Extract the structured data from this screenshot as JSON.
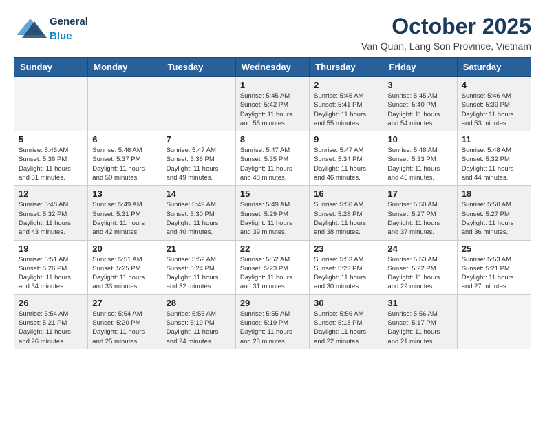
{
  "logo": {
    "general": "General",
    "blue": "Blue"
  },
  "title": "October 2025",
  "subtitle": "Van Quan, Lang Son Province, Vietnam",
  "weekdays": [
    "Sunday",
    "Monday",
    "Tuesday",
    "Wednesday",
    "Thursday",
    "Friday",
    "Saturday"
  ],
  "weeks": [
    [
      {
        "day": "",
        "empty": true
      },
      {
        "day": "",
        "empty": true
      },
      {
        "day": "",
        "empty": true
      },
      {
        "day": "1",
        "sunrise": "5:45 AM",
        "sunset": "5:42 PM",
        "daylight": "11 hours and 56 minutes."
      },
      {
        "day": "2",
        "sunrise": "5:45 AM",
        "sunset": "5:41 PM",
        "daylight": "11 hours and 55 minutes."
      },
      {
        "day": "3",
        "sunrise": "5:45 AM",
        "sunset": "5:40 PM",
        "daylight": "11 hours and 54 minutes."
      },
      {
        "day": "4",
        "sunrise": "5:46 AM",
        "sunset": "5:39 PM",
        "daylight": "11 hours and 53 minutes."
      }
    ],
    [
      {
        "day": "5",
        "sunrise": "5:46 AM",
        "sunset": "5:38 PM",
        "daylight": "11 hours and 51 minutes."
      },
      {
        "day": "6",
        "sunrise": "5:46 AM",
        "sunset": "5:37 PM",
        "daylight": "11 hours and 50 minutes."
      },
      {
        "day": "7",
        "sunrise": "5:47 AM",
        "sunset": "5:36 PM",
        "daylight": "11 hours and 49 minutes."
      },
      {
        "day": "8",
        "sunrise": "5:47 AM",
        "sunset": "5:35 PM",
        "daylight": "11 hours and 48 minutes."
      },
      {
        "day": "9",
        "sunrise": "5:47 AM",
        "sunset": "5:34 PM",
        "daylight": "11 hours and 46 minutes."
      },
      {
        "day": "10",
        "sunrise": "5:48 AM",
        "sunset": "5:33 PM",
        "daylight": "11 hours and 45 minutes."
      },
      {
        "day": "11",
        "sunrise": "5:48 AM",
        "sunset": "5:32 PM",
        "daylight": "11 hours and 44 minutes."
      }
    ],
    [
      {
        "day": "12",
        "sunrise": "5:48 AM",
        "sunset": "5:32 PM",
        "daylight": "11 hours and 43 minutes."
      },
      {
        "day": "13",
        "sunrise": "5:49 AM",
        "sunset": "5:31 PM",
        "daylight": "11 hours and 42 minutes."
      },
      {
        "day": "14",
        "sunrise": "5:49 AM",
        "sunset": "5:30 PM",
        "daylight": "11 hours and 40 minutes."
      },
      {
        "day": "15",
        "sunrise": "5:49 AM",
        "sunset": "5:29 PM",
        "daylight": "11 hours and 39 minutes."
      },
      {
        "day": "16",
        "sunrise": "5:50 AM",
        "sunset": "5:28 PM",
        "daylight": "11 hours and 38 minutes."
      },
      {
        "day": "17",
        "sunrise": "5:50 AM",
        "sunset": "5:27 PM",
        "daylight": "11 hours and 37 minutes."
      },
      {
        "day": "18",
        "sunrise": "5:50 AM",
        "sunset": "5:27 PM",
        "daylight": "11 hours and 36 minutes."
      }
    ],
    [
      {
        "day": "19",
        "sunrise": "5:51 AM",
        "sunset": "5:26 PM",
        "daylight": "11 hours and 34 minutes."
      },
      {
        "day": "20",
        "sunrise": "5:51 AM",
        "sunset": "5:25 PM",
        "daylight": "11 hours and 33 minutes."
      },
      {
        "day": "21",
        "sunrise": "5:52 AM",
        "sunset": "5:24 PM",
        "daylight": "11 hours and 32 minutes."
      },
      {
        "day": "22",
        "sunrise": "5:52 AM",
        "sunset": "5:23 PM",
        "daylight": "11 hours and 31 minutes."
      },
      {
        "day": "23",
        "sunrise": "5:53 AM",
        "sunset": "5:23 PM",
        "daylight": "11 hours and 30 minutes."
      },
      {
        "day": "24",
        "sunrise": "5:53 AM",
        "sunset": "5:22 PM",
        "daylight": "11 hours and 29 minutes."
      },
      {
        "day": "25",
        "sunrise": "5:53 AM",
        "sunset": "5:21 PM",
        "daylight": "11 hours and 27 minutes."
      }
    ],
    [
      {
        "day": "26",
        "sunrise": "5:54 AM",
        "sunset": "5:21 PM",
        "daylight": "11 hours and 26 minutes."
      },
      {
        "day": "27",
        "sunrise": "5:54 AM",
        "sunset": "5:20 PM",
        "daylight": "11 hours and 25 minutes."
      },
      {
        "day": "28",
        "sunrise": "5:55 AM",
        "sunset": "5:19 PM",
        "daylight": "11 hours and 24 minutes."
      },
      {
        "day": "29",
        "sunrise": "5:55 AM",
        "sunset": "5:19 PM",
        "daylight": "11 hours and 23 minutes."
      },
      {
        "day": "30",
        "sunrise": "5:56 AM",
        "sunset": "5:18 PM",
        "daylight": "11 hours and 22 minutes."
      },
      {
        "day": "31",
        "sunrise": "5:56 AM",
        "sunset": "5:17 PM",
        "daylight": "11 hours and 21 minutes."
      },
      {
        "day": "",
        "empty": true
      }
    ]
  ]
}
